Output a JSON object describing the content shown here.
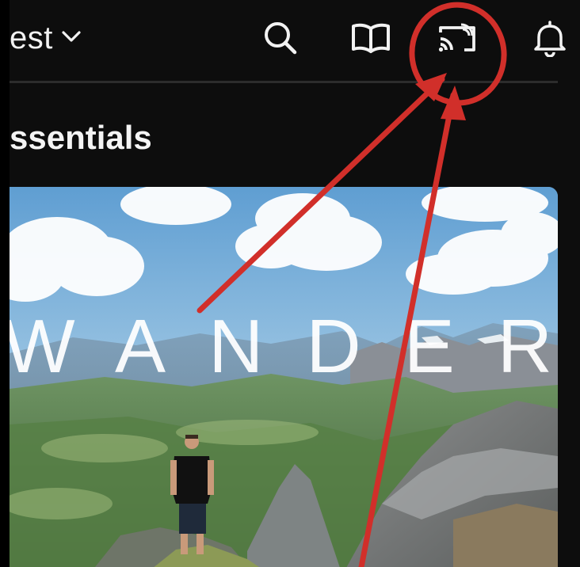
{
  "header": {
    "dropdown_label": "est",
    "icons": {
      "search": "search-icon",
      "library": "open-book-icon",
      "cast": "cast-icon",
      "notifications": "bell-icon"
    }
  },
  "section": {
    "title": "ssentials"
  },
  "hero": {
    "title": "WANDER"
  },
  "annotation": {
    "color": "#d12f2a",
    "shapes": [
      "circle-highlight",
      "arrow",
      "arrow"
    ]
  }
}
